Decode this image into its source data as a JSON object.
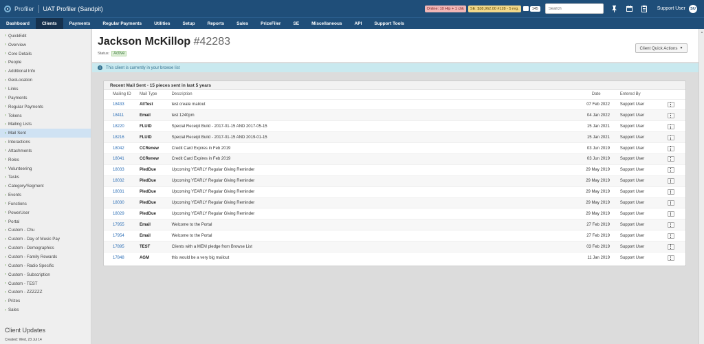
{
  "topbar": {
    "brand": "Profiler",
    "title": "UAT Profiler (Sandpit)",
    "online_badge": "Online: 10 Hlp + 1 chk",
    "se_badge": "SE: $38,962.00 #128 - 5 reg.",
    "count": "145",
    "search_placeholder": "Search",
    "user_name": "Support User",
    "avatar_initials": "SU"
  },
  "nav": [
    "Dashboard",
    "Clients",
    "Payments",
    "Regular Payments",
    "Utilities",
    "Setup",
    "Reports",
    "Sales",
    "PrizeFiler",
    "SE",
    "Miscellaneous",
    "API",
    "Support Tools"
  ],
  "sidebar": {
    "items": [
      "QuickEdit",
      "Overview",
      "Core Details",
      "People",
      "Additional Info",
      "GeoLocation",
      "Links",
      "Payments",
      "Regular Payments",
      "Tokens",
      "Mailing Lists",
      "Mail Sent",
      "Interactions",
      "Attachments",
      "Roles",
      "Volunteering",
      "Tasks",
      "Category/Segment",
      "Events",
      "Functions",
      "PowerUser",
      "Portal",
      "Custom - Chu",
      "Custom - Day of Music Pay",
      "Custom - Demographics",
      "Custom - Family Rewards",
      "Custom - Radio Specific",
      "Custom - Subscription",
      "Custom - TEST",
      "Custom - ZZZZZZ",
      "Prizes",
      "Sales"
    ],
    "active_index": 11,
    "footer_title": "Client Updates",
    "footer_created": "Created: Wed, 23 Jul 14"
  },
  "client": {
    "name": "Jackson McKillop",
    "id": "#42283",
    "status_label": "Status:",
    "status": "Active",
    "quick_actions": "Client Quick Actions"
  },
  "alert": {
    "icon": "i",
    "text": "This client is currently in your browse list"
  },
  "panel": {
    "title": "Recent Mail Sent - 15 pieces sent in last 5 years",
    "columns": [
      "Mailing ID",
      "Mail Type",
      "Description",
      "Date",
      "Entered By"
    ],
    "rows": [
      {
        "id": "18433",
        "type": "AllTest",
        "desc": "test create mailout",
        "date": "07 Feb 2022",
        "by": "Support User"
      },
      {
        "id": "18411",
        "type": "Email",
        "desc": "test 1240pm",
        "date": "04 Jan 2022",
        "by": "Support User"
      },
      {
        "id": "18220",
        "type": "FLUID",
        "desc": "Special Receipt Build - 2017-01-15 AND 2017-05-15",
        "date": "15 Jan 2021",
        "by": "Support User"
      },
      {
        "id": "18216",
        "type": "FLUID",
        "desc": "Special Receipt Build - 2017-01-15 AND 2019-01-15",
        "date": "15 Jan 2021",
        "by": "Support User"
      },
      {
        "id": "18042",
        "type": "CCRenew",
        "desc": "Credit Card Expires in Feb 2019",
        "date": "03 Jun 2019",
        "by": "Support User"
      },
      {
        "id": "18041",
        "type": "CCRenew",
        "desc": "Credit Card Expires in Feb 2019",
        "date": "03 Jun 2019",
        "by": "Support User"
      },
      {
        "id": "18033",
        "type": "PledDue",
        "desc": "Upcoming YEARLY Regular Giving Reminder",
        "date": "29 May 2019",
        "by": "Support User"
      },
      {
        "id": "18032",
        "type": "PledDue",
        "desc": "Upcoming YEARLY Regular Giving Reminder",
        "date": "29 May 2019",
        "by": "Support User"
      },
      {
        "id": "18031",
        "type": "PledDue",
        "desc": "Upcoming YEARLY Regular Giving Reminder",
        "date": "29 May 2019",
        "by": "Support User"
      },
      {
        "id": "18030",
        "type": "PledDue",
        "desc": "Upcoming YEARLY Regular Giving Reminder",
        "date": "29 May 2019",
        "by": "Support User"
      },
      {
        "id": "18029",
        "type": "PledDue",
        "desc": "Upcoming YEARLY Regular Giving Reminder",
        "date": "29 May 2019",
        "by": "Support User"
      },
      {
        "id": "17955",
        "type": "Email",
        "desc": "Welcome to the Portal",
        "date": "27 Feb 2019",
        "by": "Support User"
      },
      {
        "id": "17954",
        "type": "Email",
        "desc": "Welcome to the Portal",
        "date": "27 Feb 2019",
        "by": "Support User"
      },
      {
        "id": "17895",
        "type": "TEST",
        "desc": "Clients with a MEM pledge from Browse List",
        "date": "03 Feb 2019",
        "by": "Support User"
      },
      {
        "id": "17848",
        "type": "AGM",
        "desc": "this would be a very big mailout",
        "date": "11 Jan 2019",
        "by": "Support User"
      }
    ]
  },
  "icons": {
    "logo": "profiler-logo-icon",
    "pin": "pin-icon",
    "calendar": "calendar-icon",
    "clipboard": "clipboard-icon",
    "chevron": "chevron-right-icon",
    "kebab": "more-vertical-icon",
    "info": "info-icon"
  },
  "colors": {
    "topbar": "#1f4e79",
    "active_nav": "#16314d",
    "link": "#2a6db5",
    "alert_bg": "#c9e9ef",
    "status_bg": "#dff0d8",
    "sidebar_active": "#cfe2f3",
    "chevron": "#5a9f3c"
  }
}
